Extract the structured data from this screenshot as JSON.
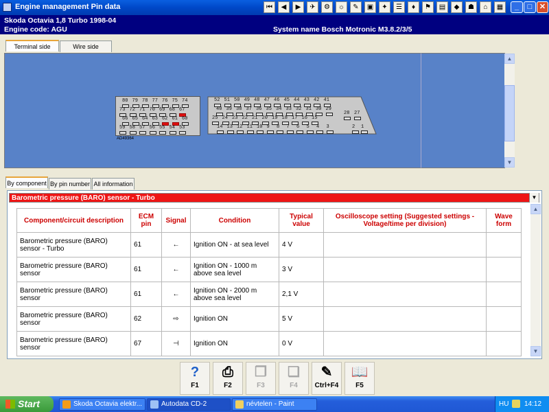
{
  "window": {
    "title": "Engine management Pin data",
    "buttons": [
      "_",
      "□",
      "✕"
    ]
  },
  "toolbar": {
    "icons": [
      "first-icon",
      "prev-icon",
      "next-icon",
      "tool1-icon",
      "tool2-icon",
      "tool3-icon",
      "tool4-icon",
      "tool5-icon",
      "tool6-icon",
      "tool7-icon",
      "tool8-icon",
      "tool9-icon",
      "tool10-icon",
      "tool11-icon",
      "tool12-icon",
      "tool13-icon",
      "tool14-icon"
    ]
  },
  "header": {
    "vehicle": "Skoda   Octavia 1,8 Turbo 1998-04",
    "engine_code": "Engine code: AGU",
    "system": "System name Bosch Motronic M3.8.2/3/5"
  },
  "top_tabs": [
    {
      "label": "Terminal side",
      "active": true
    },
    {
      "label": "Wire side",
      "active": false
    }
  ],
  "connector": {
    "label": "AD49364",
    "left_rows": [
      [
        "80",
        "79",
        "78",
        "77",
        "76",
        "75",
        "74"
      ],
      [
        "73",
        "72",
        "71",
        "70",
        "69",
        "68",
        "67"
      ],
      [
        "66",
        "65",
        "64",
        "63",
        "62",
        "61",
        "60"
      ],
      [
        "59",
        "58",
        "57",
        "56",
        "55",
        "54",
        "53"
      ]
    ],
    "right_rows": [
      [
        "52",
        "51",
        "50",
        "49",
        "48",
        "47",
        "46",
        "45",
        "44",
        "43",
        "42",
        "41"
      ],
      [
        "40",
        "39",
        "38",
        "37",
        "36",
        "35",
        "34",
        "33",
        "32",
        "31",
        "30",
        "29"
      ],
      [
        "25",
        "24",
        "23",
        "22",
        "21",
        "20",
        "19",
        "18",
        "17",
        "16",
        "15"
      ],
      [
        "14",
        "13",
        "12",
        "11",
        "10",
        "9",
        "8",
        "7",
        "6",
        "5",
        "4",
        "3"
      ]
    ],
    "right_extra": [
      [
        "28",
        "27"
      ],
      [
        "2",
        "1"
      ]
    ],
    "highlighted": [
      "61",
      "62",
      "67"
    ]
  },
  "bottom_tabs": [
    {
      "label": "By component",
      "active": true
    },
    {
      "label": "By pin number",
      "active": false
    },
    {
      "label": "All information",
      "active": false
    }
  ],
  "selector": {
    "value": "Barometric pressure (BARO) sensor - Turbo",
    "color": "#ee1515"
  },
  "table": {
    "headers": [
      "Component/circuit description",
      "ECM pin",
      "Signal",
      "Condition",
      "Typical value",
      "Oscilloscope setting (Suggested settings - Voltage/time per division)",
      "Wave form"
    ],
    "rows": [
      {
        "desc": "Barometric pressure (BARO) sensor - Turbo",
        "pin": "61",
        "signal": "←",
        "condition": "Ignition ON - at sea level",
        "value": "4 V",
        "osc": "",
        "wave": ""
      },
      {
        "desc": "Barometric pressure (BARO) sensor",
        "pin": "61",
        "signal": "←",
        "condition": "Ignition ON - 1000 m above sea level",
        "value": "3 V",
        "osc": "",
        "wave": ""
      },
      {
        "desc": "Barometric pressure (BARO) sensor",
        "pin": "61",
        "signal": "←",
        "condition": "Ignition ON - 2000 m above sea level",
        "value": "2,1 V",
        "osc": "",
        "wave": ""
      },
      {
        "desc": "Barometric pressure (BARO) sensor",
        "pin": "62",
        "signal": "⇨",
        "condition": "Ignition ON",
        "value": "5 V",
        "osc": "",
        "wave": ""
      },
      {
        "desc": "Barometric pressure (BARO) sensor",
        "pin": "67",
        "signal": "⊣",
        "condition": "Ignition ON",
        "value": "0 V",
        "osc": "",
        "wave": ""
      }
    ]
  },
  "function_keys": [
    {
      "key": "F1",
      "icon": "help-icon",
      "enabled": true
    },
    {
      "key": "F2",
      "icon": "printer-icon",
      "enabled": true
    },
    {
      "key": "F3",
      "icon": "copy-icon",
      "enabled": false
    },
    {
      "key": "F4",
      "icon": "paste-icon",
      "enabled": false
    },
    {
      "key": "Ctrl+F4",
      "icon": "notes-icon",
      "enabled": true
    },
    {
      "key": "F5",
      "icon": "book-icon",
      "enabled": true
    }
  ],
  "taskbar": {
    "start": "Start",
    "tasks": [
      {
        "label": "Skoda Octavia elektr...",
        "active": false
      },
      {
        "label": "Autodata CD-2",
        "active": true
      },
      {
        "label": "névtelen - Paint",
        "active": false
      }
    ],
    "lang": "HU",
    "clock": "14:12"
  }
}
